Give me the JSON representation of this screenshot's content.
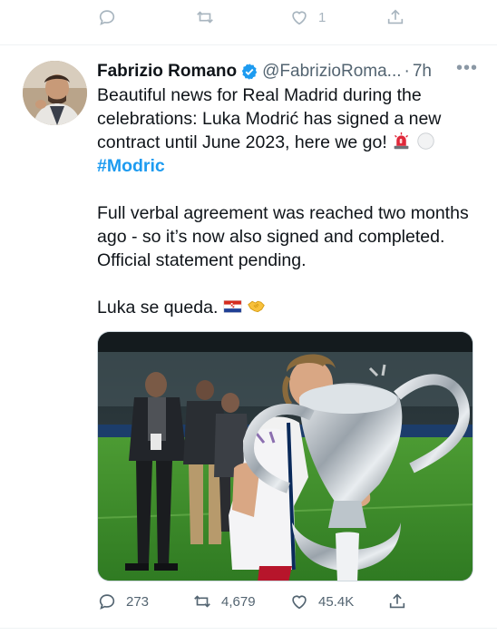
{
  "previous_tweet": {
    "like_count": "1"
  },
  "tweet": {
    "author_name": "Fabrizio Romano",
    "handle": "@FabrizioRoma...",
    "separator": "·",
    "time": "7h",
    "more": "•••",
    "text_line1": "Beautiful news for Real Madrid during the celebrations: Luka Modrić has signed a new contract until June 2023, here we go!",
    "hashtag": "#Modric",
    "text_para2": "Full verbal agreement was reached two months ago - so it’s now also signed and completed. Official statement pending.",
    "text_para3": "Luka se queda.",
    "reply_count": "273",
    "retweet_count": "4,679",
    "like_count": "45.4K"
  },
  "colors": {
    "link": "#1d9bf0",
    "verified": "#1d9bf0",
    "secondary_text": "#536471",
    "pitch_green": "#3f8f2b"
  },
  "icons": {
    "reply": "reply-icon",
    "retweet": "retweet-icon",
    "like": "heart-icon",
    "share": "share-icon",
    "verified": "verified-badge-icon",
    "more": "more-icon",
    "siren": "police-light-emoji",
    "ball": "white-circle-emoji",
    "flag": "croatia-flag-emoji",
    "handshake": "handshake-emoji"
  }
}
